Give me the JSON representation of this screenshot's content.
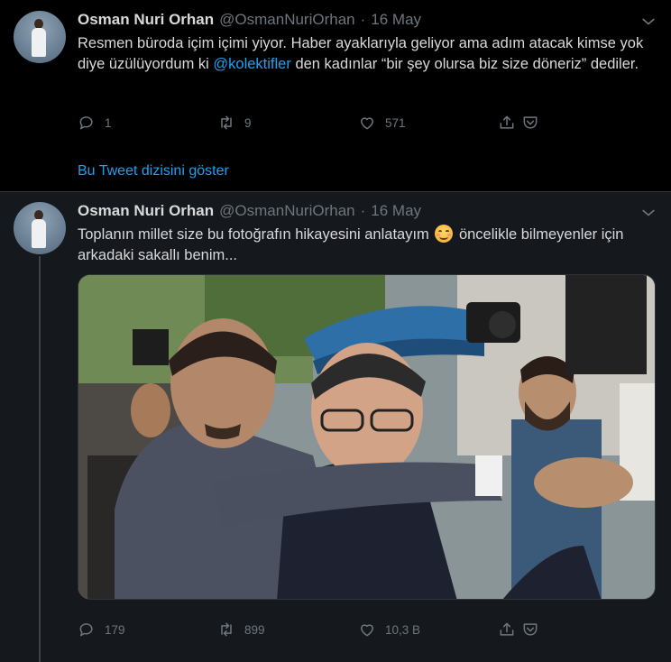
{
  "tweets": [
    {
      "author_name": "Osman Nuri Orhan",
      "author_handle": "@OsmanNuriOrhan",
      "separator": "·",
      "date": "16 May",
      "text_before_mention": "Resmen büroda içim içimi yiyor. Haber ayaklarıyla geliyor ama adım atacak kimse yok diye üzülüyordum ki ",
      "mention": "@kolektifler",
      "text_after_mention": " den kadınlar “bir şey olursa biz size döneriz” dediler.",
      "replies": "1",
      "retweets": "9",
      "likes": "571",
      "show_thread_label": "Bu Tweet dizisini göster"
    },
    {
      "author_name": "Osman Nuri Orhan",
      "author_handle": "@OsmanNuriOrhan",
      "separator": "·",
      "date": "16 May",
      "text_before_emoji": "Toplanın millet size bu fotoğrafın hikayesini anlatayım ",
      "text_after_emoji": " öncelikle bilmeyenler için arkadaki sakallı benim...",
      "replies": "179",
      "retweets": "899",
      "likes": "10,3 B"
    }
  ],
  "icons": {
    "reply": "speech-bubble-icon",
    "retweet": "retweet-arrows-icon",
    "like": "heart-icon",
    "share": "share-upload-icon",
    "bookmark": "pocket-save-icon",
    "more": "chevron-down-icon",
    "emoji": "smiling-face-with-smiling-eyes"
  },
  "colors": {
    "background_first": "#000000",
    "background_second": "#15181c",
    "link": "#1da1f2",
    "muted": "#6e767d",
    "text": "#d9d9d9"
  }
}
